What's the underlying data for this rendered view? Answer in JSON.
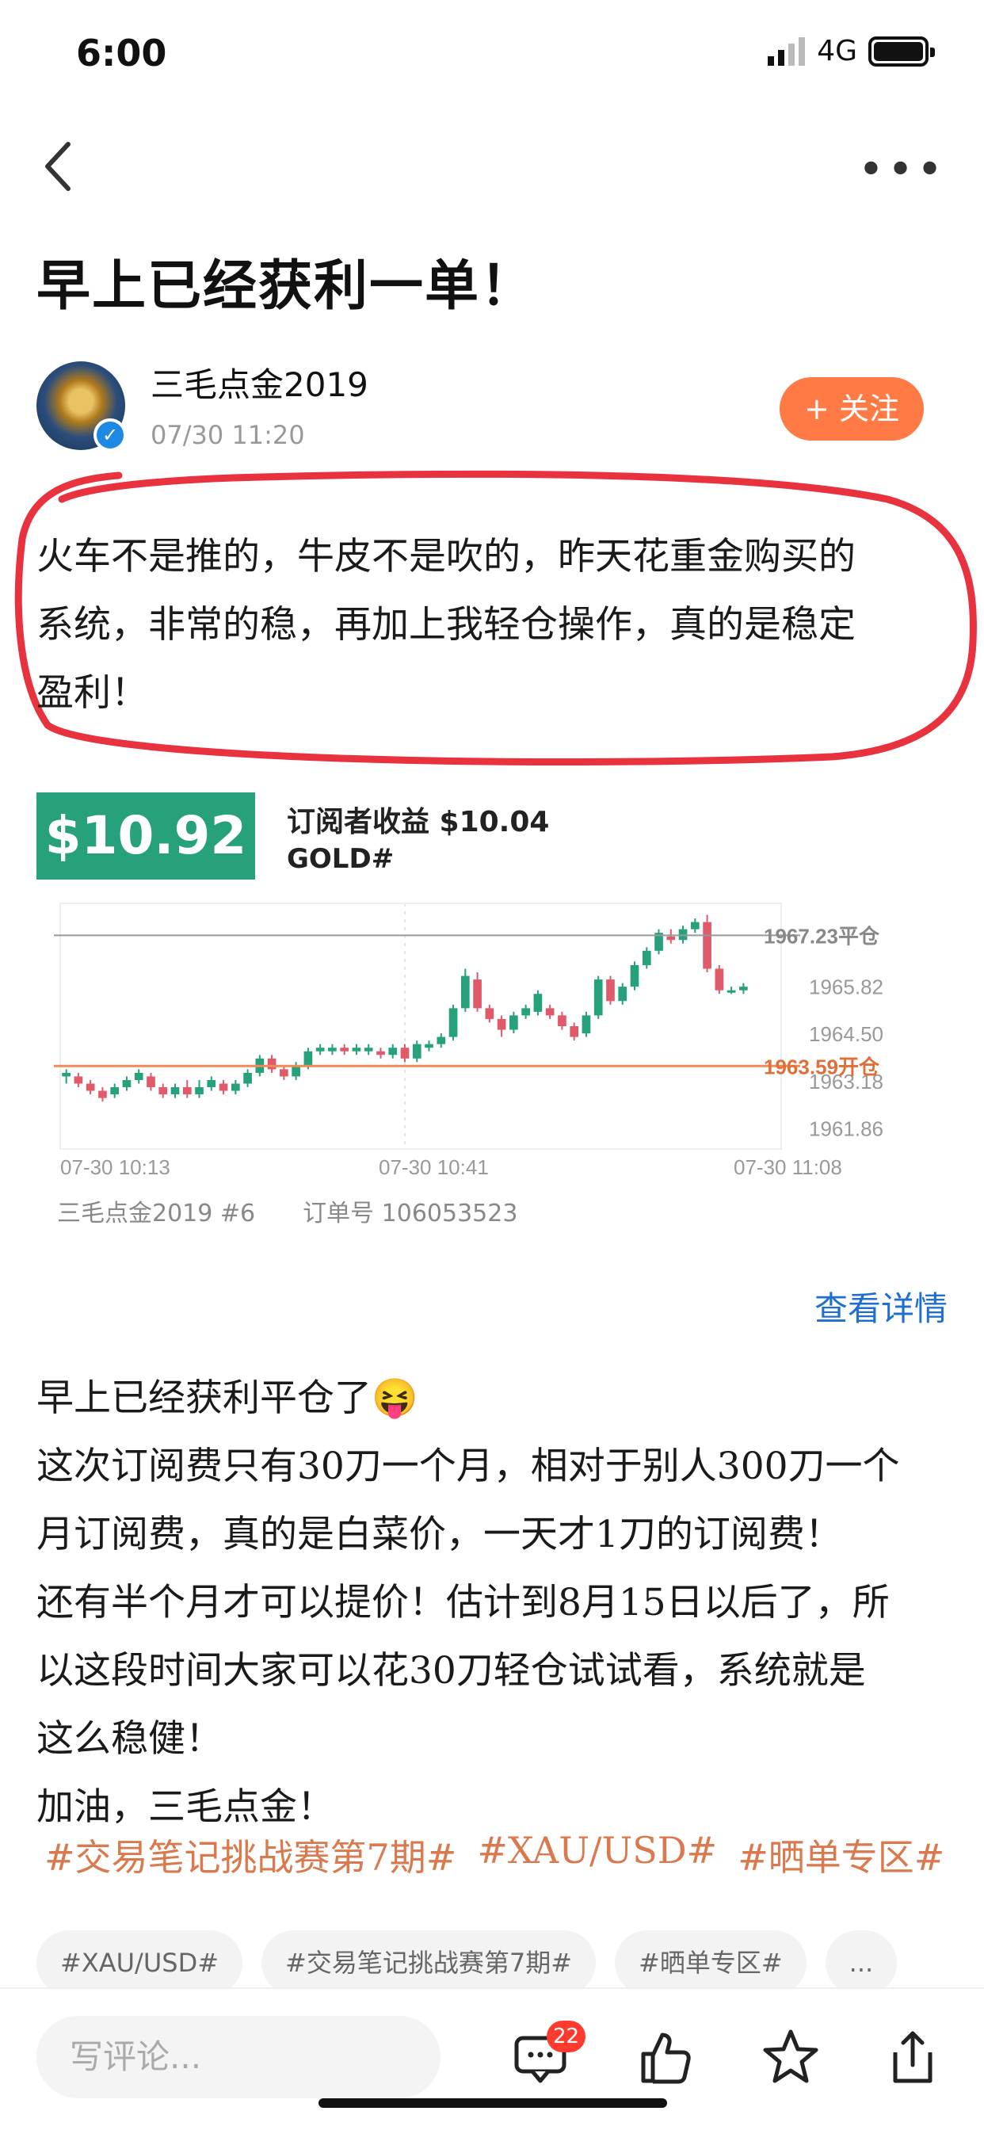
{
  "status": {
    "time": "6:00",
    "network": "4G"
  },
  "post": {
    "title": "早上已经获利一单！",
    "author": "三毛点金2019",
    "time": "07/30 11:20",
    "follow_label": "+ 关注",
    "intro_lines": [
      "火车不是推的，牛皮不是吹的，昨天花重金购买的",
      "系统，非常的稳，再加上我轻仓操作，真的是稳定",
      "盈利！"
    ],
    "body_lines": [
      "早上已经获利平仓了😝",
      "这次订阅费只有30刀一个月，相对于别人300刀一个",
      "月订阅费，真的是白菜价，一天才1刀的订阅费！",
      "还有半个月才可以提价！估计到8月15日以后了，所",
      "以这段时间大家可以花30刀轻仓试试看，系统就是",
      "这么稳健！",
      "加油，三毛点金！"
    ],
    "hashtags": [
      "#交易笔记挑战赛第7期#",
      "#XAU/USD#",
      "#晒单专区#"
    ],
    "chips": [
      "#XAU/USD#",
      "#交易笔记挑战赛第7期#",
      "#晒单专区#",
      "..."
    ]
  },
  "trade": {
    "profit": "$10.92",
    "subscriber_profit": "订阅者收益 $10.04",
    "symbol": "GOLD#",
    "meta": "三毛点金2019 #6　　订单号 106053523",
    "detail_link": "查看详情"
  },
  "chart_data": {
    "type": "candlestick",
    "y_ticks": [
      "1965.82",
      "1964.50",
      "1963.18",
      "1961.86"
    ],
    "x_ticks": [
      "07-30 10:13",
      "07-30 10:41",
      "07-30 11:08"
    ],
    "close_level": {
      "value": 1967.23,
      "label": "1967.23平仓"
    },
    "open_level": {
      "value": 1963.59,
      "label": "1963.59开仓"
    },
    "ylim": [
      1961.5,
      1967.9
    ],
    "up_color": "#26a17b",
    "down_color": "#e05a6a",
    "candles": [
      [
        1963.3,
        1963.4,
        1963.1,
        1963.5
      ],
      [
        1963.3,
        1963.1,
        1963.0,
        1963.4
      ],
      [
        1963.1,
        1962.9,
        1962.8,
        1963.2
      ],
      [
        1962.9,
        1962.7,
        1962.6,
        1963.0
      ],
      [
        1962.8,
        1963.0,
        1962.7,
        1963.1
      ],
      [
        1963.0,
        1963.2,
        1962.9,
        1963.3
      ],
      [
        1963.2,
        1963.4,
        1963.1,
        1963.5
      ],
      [
        1963.3,
        1963.0,
        1962.9,
        1963.4
      ],
      [
        1963.0,
        1962.8,
        1962.7,
        1963.1
      ],
      [
        1962.8,
        1963.0,
        1962.7,
        1963.1
      ],
      [
        1963.0,
        1962.8,
        1962.7,
        1963.2
      ],
      [
        1962.8,
        1963.0,
        1962.7,
        1963.2
      ],
      [
        1963.0,
        1963.2,
        1962.9,
        1963.3
      ],
      [
        1963.1,
        1962.9,
        1962.8,
        1963.2
      ],
      [
        1962.9,
        1963.1,
        1962.8,
        1963.2
      ],
      [
        1963.1,
        1963.4,
        1963.0,
        1963.5
      ],
      [
        1963.4,
        1963.8,
        1963.3,
        1963.9
      ],
      [
        1963.8,
        1963.5,
        1963.4,
        1963.9
      ],
      [
        1963.5,
        1963.3,
        1963.2,
        1963.6
      ],
      [
        1963.3,
        1963.6,
        1963.2,
        1963.7
      ],
      [
        1963.6,
        1964.0,
        1963.5,
        1964.1
      ],
      [
        1964.0,
        1964.1,
        1963.9,
        1964.2
      ],
      [
        1964.0,
        1964.1,
        1963.9,
        1964.2
      ],
      [
        1964.1,
        1964.0,
        1963.9,
        1964.2
      ],
      [
        1964.0,
        1964.1,
        1963.9,
        1964.2
      ],
      [
        1964.0,
        1964.1,
        1963.9,
        1964.2
      ],
      [
        1964.0,
        1963.9,
        1963.8,
        1964.1
      ],
      [
        1963.9,
        1964.1,
        1963.8,
        1964.2
      ],
      [
        1964.1,
        1963.8,
        1963.7,
        1964.2
      ],
      [
        1963.8,
        1964.2,
        1963.7,
        1964.3
      ],
      [
        1964.1,
        1964.2,
        1964.0,
        1964.3
      ],
      [
        1964.2,
        1964.4,
        1964.1,
        1964.5
      ],
      [
        1964.4,
        1965.2,
        1964.3,
        1965.3
      ],
      [
        1965.2,
        1966.1,
        1965.1,
        1966.3
      ],
      [
        1966.0,
        1965.2,
        1965.1,
        1966.2
      ],
      [
        1965.2,
        1964.9,
        1964.8,
        1965.3
      ],
      [
        1964.9,
        1964.6,
        1964.4,
        1965.0
      ],
      [
        1964.6,
        1965.0,
        1964.5,
        1965.1
      ],
      [
        1965.0,
        1965.2,
        1964.9,
        1965.3
      ],
      [
        1965.1,
        1965.6,
        1965.0,
        1965.7
      ],
      [
        1965.2,
        1965.0,
        1964.9,
        1965.3
      ],
      [
        1965.0,
        1964.7,
        1964.6,
        1965.1
      ],
      [
        1964.7,
        1964.4,
        1964.3,
        1964.8
      ],
      [
        1964.5,
        1965.0,
        1964.4,
        1965.1
      ],
      [
        1965.0,
        1966.0,
        1964.9,
        1966.1
      ],
      [
        1966.0,
        1965.4,
        1965.3,
        1966.1
      ],
      [
        1965.4,
        1965.8,
        1965.3,
        1965.9
      ],
      [
        1965.8,
        1966.4,
        1965.7,
        1966.5
      ],
      [
        1966.4,
        1966.8,
        1966.3,
        1966.9
      ],
      [
        1966.8,
        1967.3,
        1966.7,
        1967.4
      ],
      [
        1967.2,
        1967.1,
        1967.0,
        1967.4
      ],
      [
        1967.1,
        1967.4,
        1967.0,
        1967.5
      ],
      [
        1967.4,
        1967.6,
        1967.3,
        1967.7
      ],
      [
        1967.6,
        1966.3,
        1966.2,
        1967.8
      ],
      [
        1966.3,
        1965.7,
        1965.6,
        1966.4
      ],
      [
        1965.7,
        1965.7,
        1965.6,
        1965.8
      ],
      [
        1965.7,
        1965.8,
        1965.6,
        1965.9
      ]
    ]
  }
}
